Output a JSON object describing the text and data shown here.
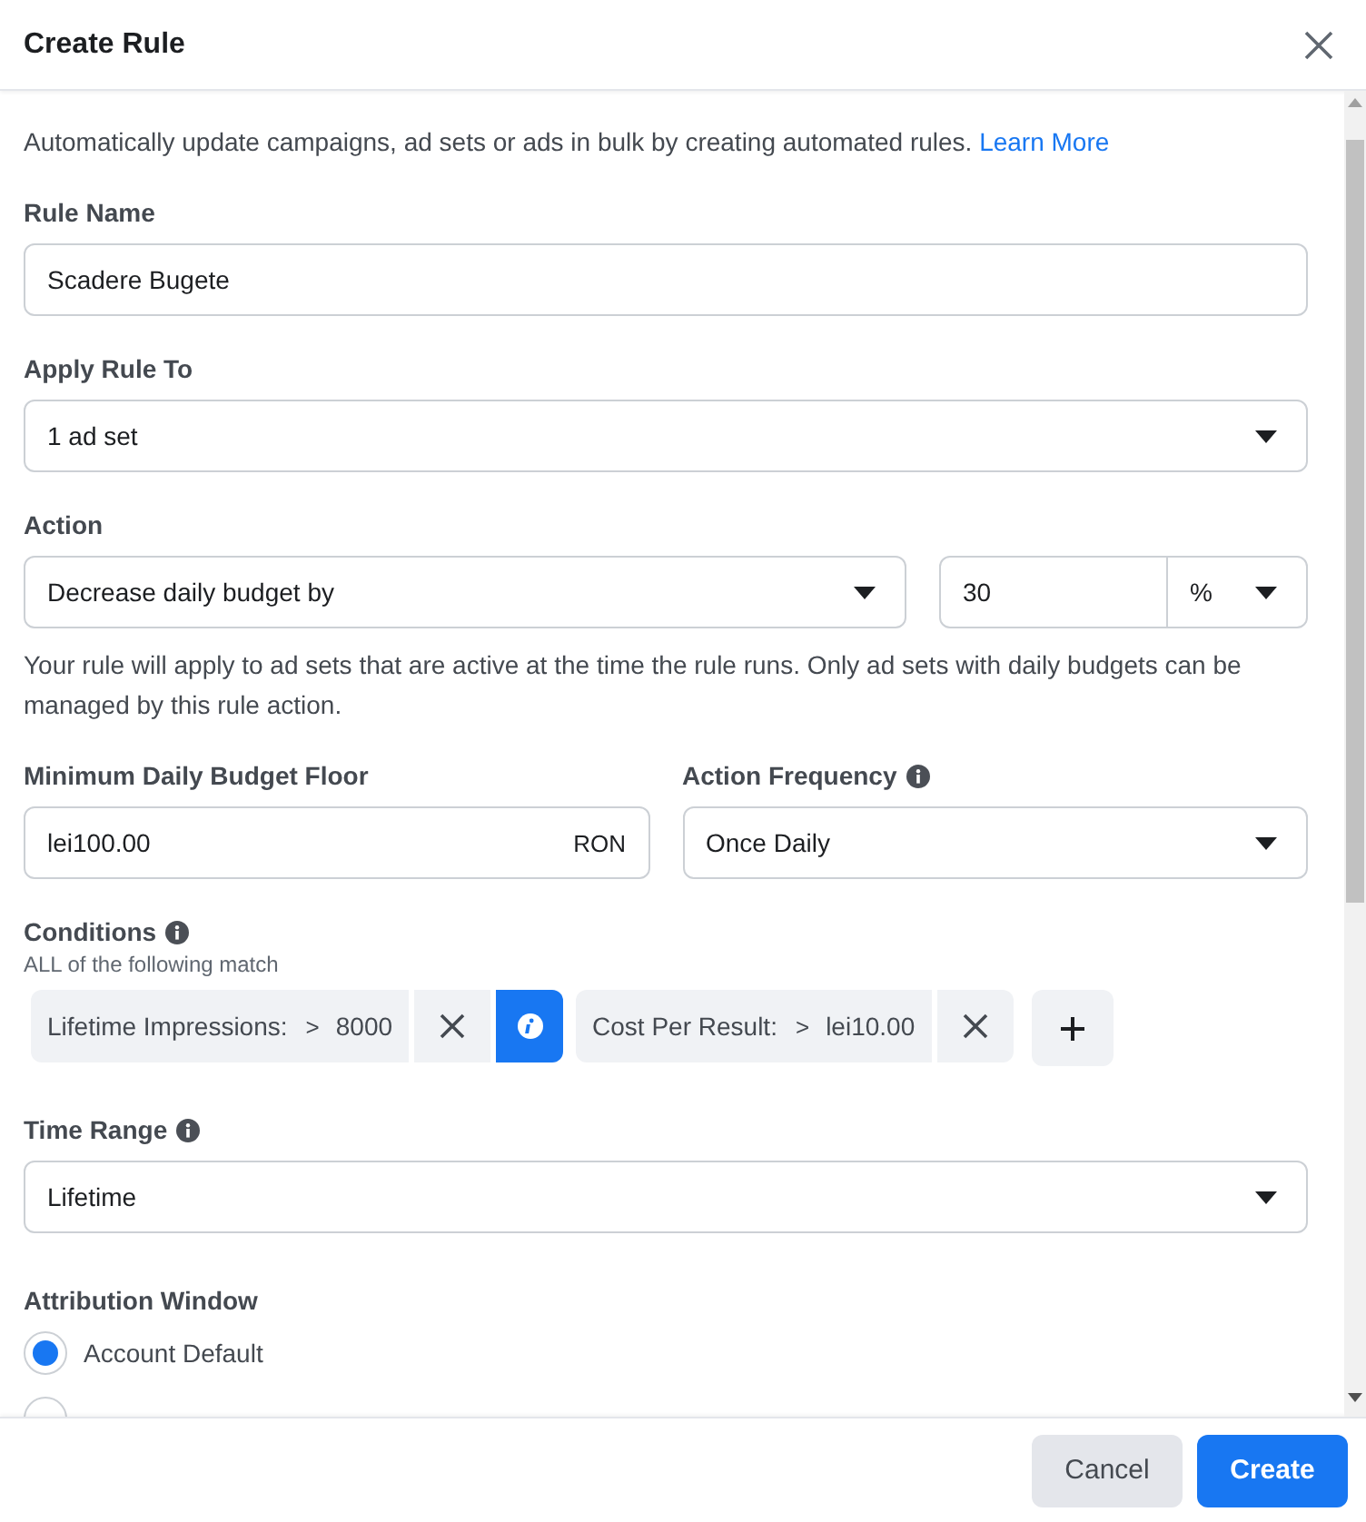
{
  "dialog": {
    "title": "Create Rule"
  },
  "intro": {
    "text": "Automatically update campaigns, ad sets or ads in bulk by creating automated rules.",
    "link": "Learn More"
  },
  "rule_name": {
    "label": "Rule Name",
    "value": "Scadere Bugete"
  },
  "apply_rule_to": {
    "label": "Apply Rule To",
    "value": "1 ad set"
  },
  "action": {
    "label": "Action",
    "value": "Decrease daily budget by",
    "amount": "30",
    "unit": "%",
    "note": "Your rule will apply to ad sets that are active at the time the rule runs. Only ad sets with daily budgets can be managed by this rule action."
  },
  "minimum_daily_budget_floor": {
    "label": "Minimum Daily Budget Floor",
    "value": "lei100.00",
    "currency": "RON"
  },
  "action_frequency": {
    "label": "Action Frequency",
    "value": "Once Daily"
  },
  "conditions": {
    "label": "Conditions",
    "subtitle": "ALL of the following match",
    "items": [
      {
        "metric": "Lifetime Impressions:",
        "operator": ">",
        "value": "8000",
        "info_button": true
      },
      {
        "metric": "Cost Per Result:",
        "operator": ">",
        "value": "lei10.00",
        "info_button": false
      }
    ]
  },
  "time_range": {
    "label": "Time Range",
    "value": "Lifetime"
  },
  "attribution_window": {
    "label": "Attribution Window",
    "options": [
      {
        "label": "Account Default",
        "selected": true
      },
      {
        "selected": false
      }
    ]
  },
  "buttons": [
    {
      "label": "Cancel",
      "kind": "secondary"
    },
    {
      "label": "Create",
      "kind": "primary"
    }
  ]
}
